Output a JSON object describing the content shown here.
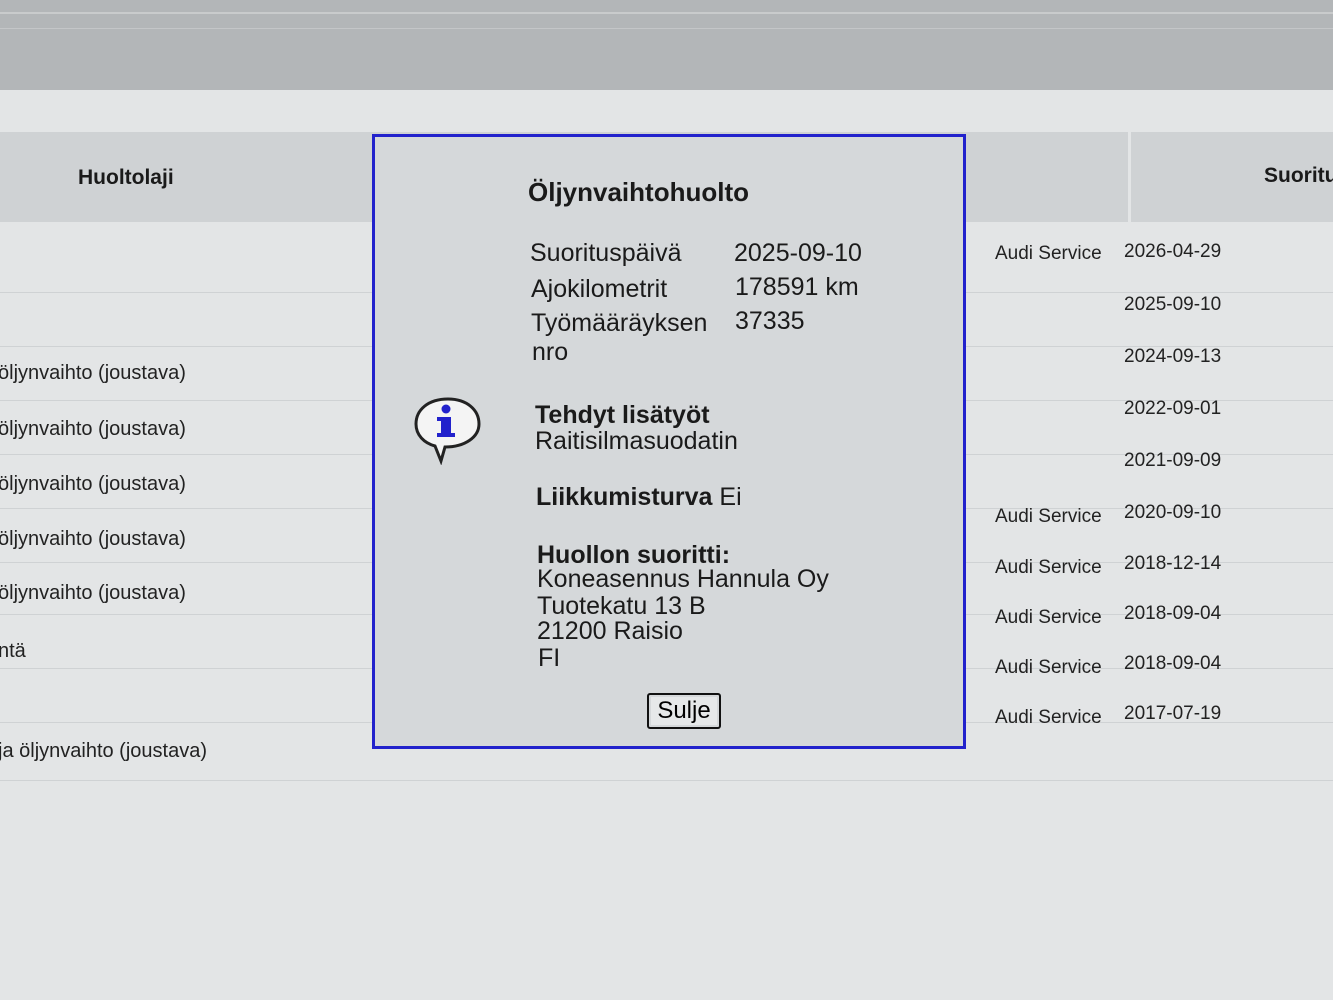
{
  "table": {
    "headers": {
      "huoltolaji": "Huoltolaji",
      "suoritus": "Suoritu"
    },
    "left_rows": [
      "öljynvaihto (joustava)",
      "öljynvaihto (joustava)",
      "öljynvaihto (joustava)",
      "öljynvaihto (joustava)",
      "öljynvaihto (joustava)",
      "ntä",
      "ja öljynvaihto (joustava)"
    ],
    "right_rows": [
      {
        "service": "Audi Service",
        "date": "2026-04-29"
      },
      {
        "service": "",
        "date": "2025-09-10"
      },
      {
        "service": "",
        "date": "2024-09-13"
      },
      {
        "service": "",
        "date": "2022-09-01"
      },
      {
        "service": "",
        "date": "2021-09-09"
      },
      {
        "service": "Audi Service",
        "date": "2020-09-10"
      },
      {
        "service": "Audi Service",
        "date": "2018-12-14"
      },
      {
        "service": "Audi Service",
        "date": "2018-09-04"
      },
      {
        "service": "Audi Service",
        "date": "2018-09-04"
      },
      {
        "service": "Audi Service",
        "date": "2017-07-19"
      }
    ]
  },
  "dialog": {
    "title": "Öljynvaihtohuolto",
    "suorituspaiva_label": "Suorituspäivä",
    "suorituspaiva_value": "2025-09-10",
    "ajokilometrit_label": "Ajokilometrit",
    "ajokilometrit_value": "178591 km",
    "tyomaarays_label_1": "Työmääräyksen",
    "tyomaarays_label_2": "nro",
    "tyomaarays_value": "37335",
    "lisatyot_label": "Tehdyt lisätyöt",
    "lisatyot_value": "Raitisilmasuodatin",
    "liikkumisturva_label": "Liikkumisturva",
    "liikkumisturva_value": "Ei",
    "suorittaja_label": "Huollon suoritti:",
    "suorittaja_lines": [
      "Koneasennus Hannula Oy",
      "Tuotekatu 13 B",
      "21200 Raisio",
      "FI"
    ],
    "close_label": "Sulje",
    "icon": "info-icon",
    "border_color": "#2222cc"
  }
}
